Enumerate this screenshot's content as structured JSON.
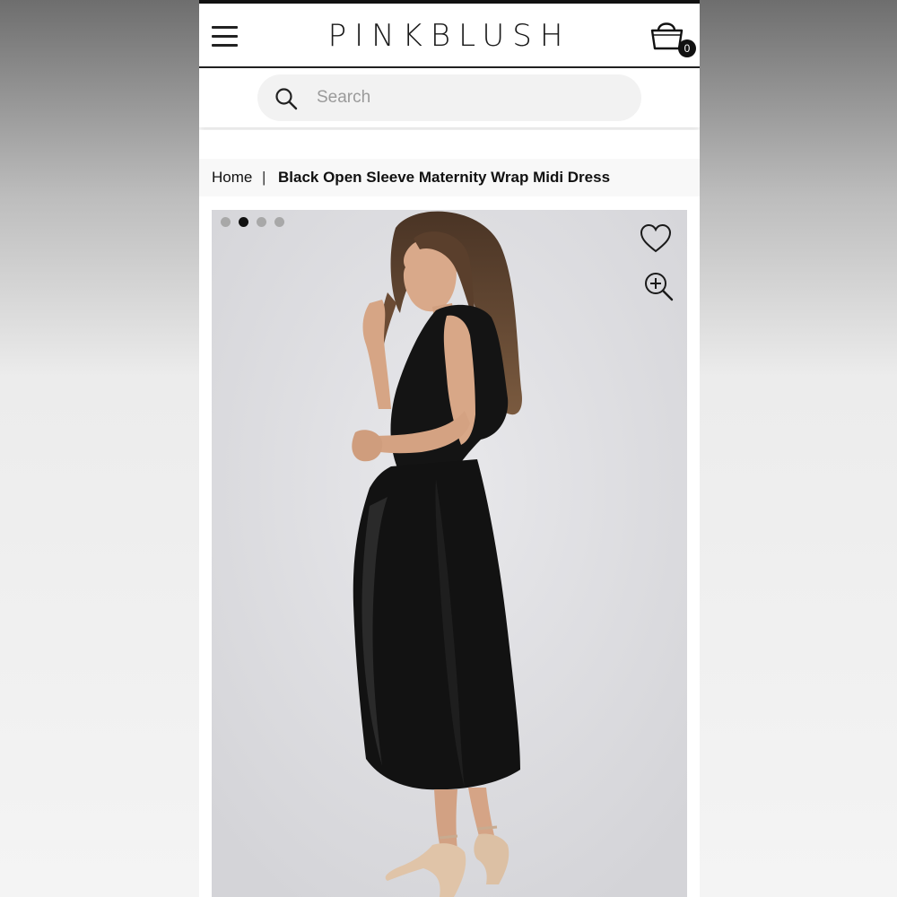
{
  "header": {
    "brand": "PINKBLUSH",
    "menu_icon": "hamburger-menu-icon",
    "cart_icon": "shopping-bag-icon",
    "cart_count": "0"
  },
  "search": {
    "placeholder": "Search",
    "value": "",
    "icon": "search-icon"
  },
  "breadcrumb": {
    "home": "Home",
    "separator": "|",
    "current": "Black Open Sleeve Maternity Wrap Midi Dress"
  },
  "gallery": {
    "image_count": 4,
    "active_index": 2,
    "favorite_icon": "heart-icon",
    "zoom_icon": "zoom-in-icon"
  },
  "colors": {
    "background": "#ffffff",
    "text": "#111111",
    "search_bg": "#f2f2f2",
    "breadcrumb_bg": "#f8f8f8",
    "dot_inactive": "#a8a8a8",
    "dot_active": "#111111"
  }
}
